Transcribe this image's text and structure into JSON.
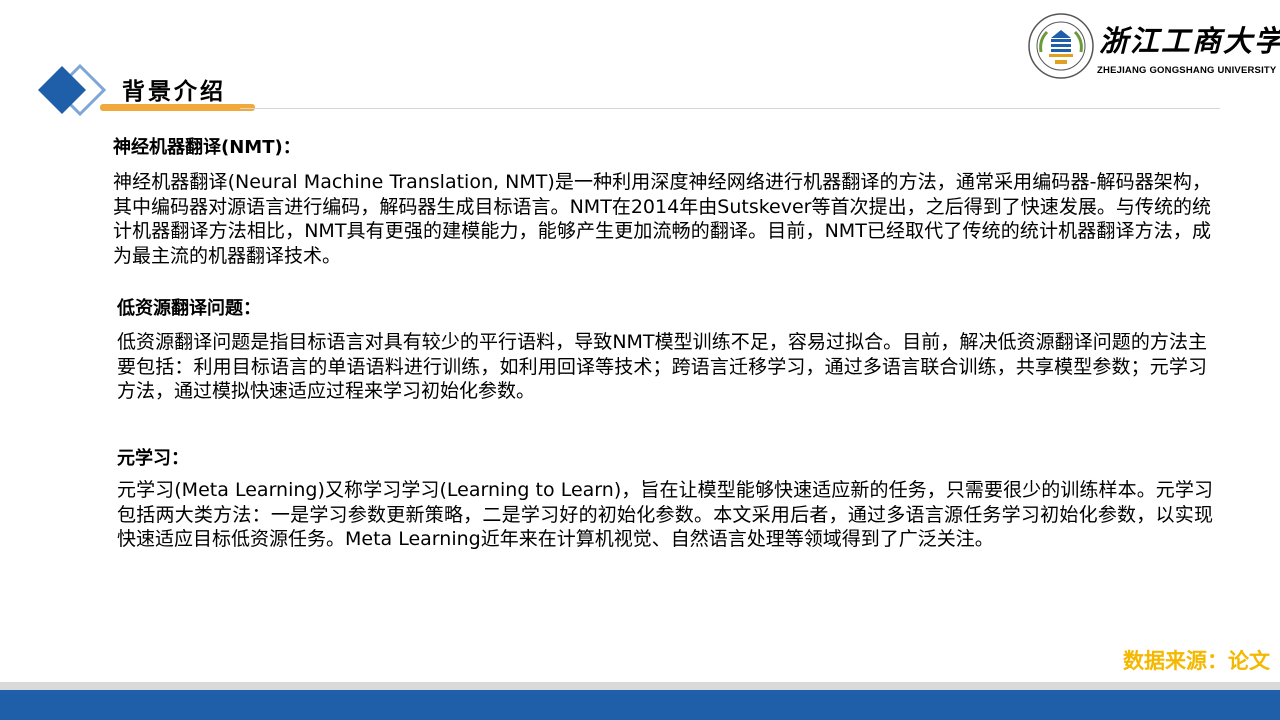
{
  "colors": {
    "primary_blue": "#1f5faa",
    "light_blue": "#7fa6d8",
    "accent_orange": "#f2a93b",
    "source_yellow": "#f5b800",
    "footer_gray": "#d9d9d9",
    "text": "#000000"
  },
  "header": {
    "title": "背景介绍",
    "icon": "diamond-icon"
  },
  "logo": {
    "name_cn": "浙江工商大学",
    "name_en": "ZHEJIANG GONGSHANG UNIVERSITY",
    "icon": "university-seal-icon"
  },
  "sections": [
    {
      "heading": "神经机器翻译(NMT)：",
      "body": "神经机器翻译(Neural Machine Translation, NMT)是一种利用深度神经网络进行机器翻译的方法，通常采用编码器-解码器架构，其中编码器对源语言进行编码，解码器生成目标语言。NMT在2014年由Sutskever等首次提出，之后得到了快速发展。与传统的统计机器翻译方法相比，NMT具有更强的建模能力，能够产生更加流畅的翻译。目前，NMT已经取代了传统的统计机器翻译方法，成为最主流的机器翻译技术。"
    },
    {
      "heading": "低资源翻译问题：",
      "body": "低资源翻译问题是指目标语言对具有较少的平行语料，导致NMT模型训练不足，容易过拟合。目前，解决低资源翻译问题的方法主要包括：利用目标语言的单语语料进行训练，如利用回译等技术；跨语言迁移学习，通过多语言联合训练，共享模型参数；元学习方法，通过模拟快速适应过程来学习初始化参数。"
    },
    {
      "heading": "元学习：",
      "body": " 元学习(Meta Learning)又称学习学习(Learning to Learn)，旨在让模型能够快速适应新的任务，只需要很少的训练样本。元学习包括两大类方法：一是学习参数更新策略，二是学习好的初始化参数。本文采用后者，通过多语言源任务学习初始化参数，以实现快速适应目标低资源任务。Meta Learning近年来在计算机视觉、自然语言处理等领域得到了广泛关注。"
    }
  ],
  "footer": {
    "source_note": "数据来源：论文"
  }
}
